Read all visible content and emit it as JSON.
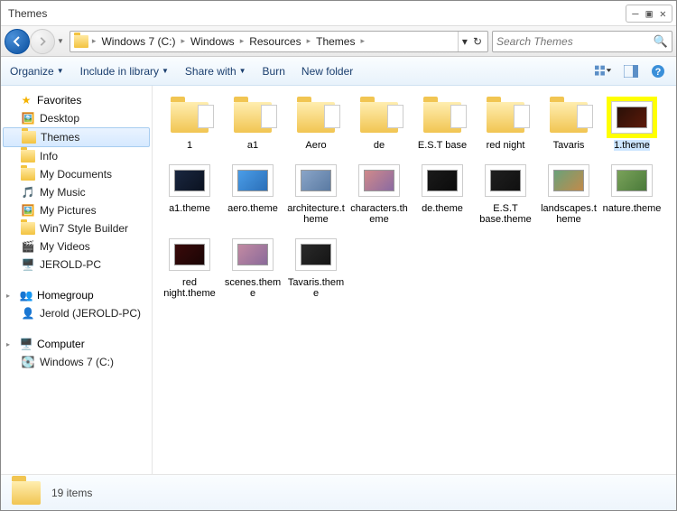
{
  "window": {
    "title": "Themes"
  },
  "breadcrumbs": [
    "Windows 7 (C:)",
    "Windows",
    "Resources",
    "Themes"
  ],
  "search": {
    "placeholder": "Search Themes"
  },
  "toolbar": {
    "organize": "Organize",
    "include": "Include in library",
    "share": "Share with",
    "burn": "Burn",
    "newfolder": "New folder"
  },
  "sidebar": {
    "favorites": "Favorites",
    "fav_items": [
      "Desktop",
      "Themes",
      "Info",
      "My Documents",
      "My Music",
      "My Pictures",
      "Win7 Style Builder",
      "My Videos",
      "JEROLD-PC"
    ],
    "homegroup": "Homegroup",
    "hg_items": [
      "Jerold (JEROLD-PC)"
    ],
    "computer": "Computer",
    "comp_items": [
      "Windows 7 (C:)"
    ]
  },
  "items": [
    {
      "name": "1",
      "type": "folder"
    },
    {
      "name": "a1",
      "type": "folder"
    },
    {
      "name": "Aero",
      "type": "folder"
    },
    {
      "name": "de",
      "type": "folder"
    },
    {
      "name": "E.S.T  base",
      "type": "folder"
    },
    {
      "name": "red night",
      "type": "folder"
    },
    {
      "name": "Tavaris",
      "type": "folder"
    },
    {
      "name": "1.theme",
      "type": "theme",
      "c1": "#2a1008",
      "c2": "#5c1a0a",
      "selected": true
    },
    {
      "name": "a1.theme",
      "type": "theme",
      "c1": "#1a2740",
      "c2": "#0b1220"
    },
    {
      "name": "aero.theme",
      "type": "theme",
      "c1": "#4a9de8",
      "c2": "#2b6fb8"
    },
    {
      "name": "architecture.theme",
      "type": "theme",
      "c1": "#8aa5c8",
      "c2": "#5a7aa2"
    },
    {
      "name": "characters.theme",
      "type": "theme",
      "c1": "#d08a8a",
      "c2": "#8a6aa2"
    },
    {
      "name": "de.theme",
      "type": "theme",
      "c1": "#1a1a1a",
      "c2": "#0b0b0b"
    },
    {
      "name": "E.S.T base.theme",
      "type": "theme",
      "c1": "#1f1f1f",
      "c2": "#101010"
    },
    {
      "name": "landscapes.theme",
      "type": "theme",
      "c1": "#6aa27a",
      "c2": "#c28a4a"
    },
    {
      "name": "nature.theme",
      "type": "theme",
      "c1": "#7aa25a",
      "c2": "#4a7a3a"
    },
    {
      "name": "red night.theme",
      "type": "theme",
      "c1": "#3a0a0a",
      "c2": "#1a0505"
    },
    {
      "name": "scenes.theme",
      "type": "theme",
      "c1": "#c28aa2",
      "c2": "#8a6a9a"
    },
    {
      "name": "Tavaris.theme",
      "type": "theme",
      "c1": "#2a2a2a",
      "c2": "#151515"
    }
  ],
  "statusbar": {
    "count_text": "19 items"
  }
}
